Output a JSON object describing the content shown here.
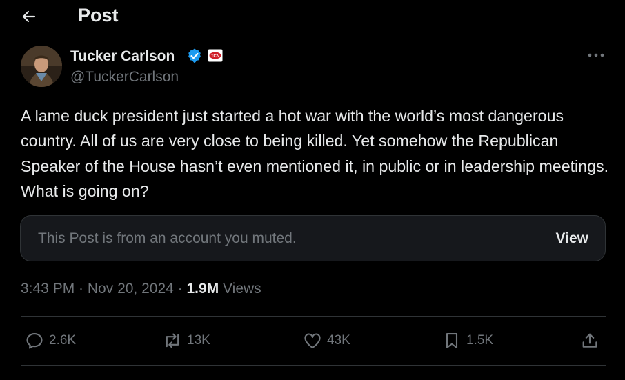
{
  "header": {
    "title": "Post",
    "back_icon": "arrow-left-icon"
  },
  "author": {
    "name": "Tucker Carlson",
    "handle": "@TuckerCarlson",
    "verified_color": "#1d9bf0",
    "affiliate_badge_text": "TCN"
  },
  "post": {
    "text": "A lame duck president just started a hot war with the world’s most dangerous country. All of us are very close to being killed. Yet somehow the Republican Speaker of the House hasn’t even mentioned it, in public or in leadership meetings. What is going on?"
  },
  "muted_notice": {
    "text": "This Post is from an account you muted.",
    "view_label": "View"
  },
  "meta": {
    "time": "3:43 PM",
    "separator": " · ",
    "date": "Nov 20, 2024",
    "views_count": "1.9M",
    "views_label": "Views"
  },
  "actions": {
    "replies": "2.6K",
    "reposts": "13K",
    "likes": "43K",
    "bookmarks": "1.5K"
  },
  "colors": {
    "background": "#000000",
    "text_primary": "#e7e9ea",
    "text_secondary": "#71767b",
    "border": "#2f3336",
    "verified": "#1d9bf0"
  }
}
